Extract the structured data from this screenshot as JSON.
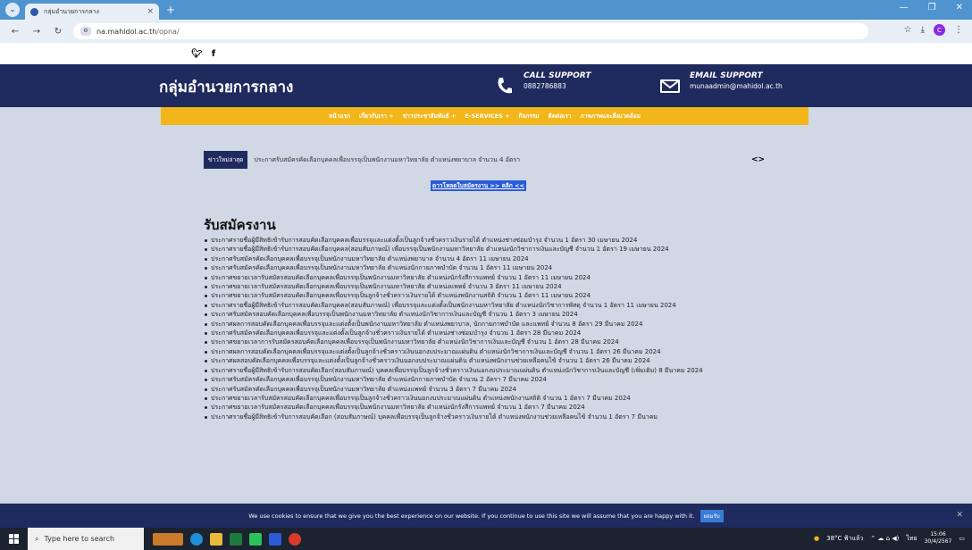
{
  "browser": {
    "tab_title": "กลุ่มอำนวยการกลาง",
    "tab_close": "×",
    "new_tab": "+",
    "url_host": "na.mahidol.ac.th",
    "url_path": "/opna/",
    "profile_initial": "C"
  },
  "site": {
    "brand": "กลุ่มอำนวยการกลาง",
    "call_support_label": "CALL SUPPORT",
    "call_support_value": "0882786883",
    "email_support_label": "EMAIL SUPPORT",
    "email_support_value": "munaadmin@mahidol.ac.th"
  },
  "menu": [
    "หน้าแรก",
    "เกี่ยวกับเรา +",
    "ข่าวประชาสัมพันธ์ +",
    "E-SERVICES +",
    "กิจกรรม",
    "ติดต่อเรา",
    "ภาพภาพและสิ่งแวดล้อม"
  ],
  "ticker": {
    "label": "ข่าวใหม่ล่าสุด",
    "text": "ประกาศรับสมัครคัดเลือกบุคคลเพื่อบรรจุเป็นพนักงานมหาวิทยาลัย ตำแหน่งพยาบาล จำนวน 4 อัตรา",
    "arrows": "<>"
  },
  "download_link": "ดาวโหลดใบสมัครงาน >> คลิก <<",
  "heading": "รับสมัครงาน",
  "jobs": [
    "ประกาศรายชื่อผู้มีสิทธิเข้ารับการสอบคัดเลือกบุคคลเพื่อบรรจุและแต่งตั้งเป็นลูกจ้างชั่วคราวเงินรายได้ ตำแหน่งช่างซ่อมบำรุง จำนวน 1 อัตรา 30 เมษายน 2024",
    "ประกาศรายชื่อผู้มีสิทธิเข้ารับการสอบคัดเลือกบุคคล(สอบสัมภาษณ์) เพื่อบรรจุเป็นพนักงานมหาวิทยาลัย ตำแหน่งนักวิชาการเงินและบัญชี จำนวน 1 อัตรา 19 เมษายน 2024",
    "ประกาศรับสมัครคัดเลือกบุคคลเพื่อบรรจุเป็นพนักงานมหาวิทยาลัย ตำแหน่งพยาบาล จำนวน 4 อัตรา 11 เมษายน 2024",
    "ประกาศรับสมัครคัดเลือกบุคคลเพื่อบรรจุเป็นพนักงานมหาวิทยาลัย ตำแหน่งนักกายภาพบำบัด จำนวน 1 อัตรา 11 เมษายน 2024",
    "ประกาศขยายเวลารับสมัครสอบคัดเลือกบุคคลเพื่อบรรจุเป็นพนักงานมหาวิทยาลัย ตำแหน่งนักรังสีการแพทย์ จำนวน 1 อัตรา 11 เมษายน 2024",
    "ประกาศขยายเวลารับสมัครสอบคัดเลือกบุคคลเพื่อบรรจุเป็นพนักงานมหาวิทยาลัย ตำแหน่งแพทย์ จำนวน 3 อัตรา 11 เมษายน 2024",
    "ประกาศขยายเวลารับสมัครสอบคัดเลือกบุคคลเพื่อบรรจุเป็นลูกจ้างชั่วคราวเงินรายได้ ตำแหน่งพนักงานสถิติ จำนวน 1 อัตรา 11 เมษายน 2024",
    "ประกาศรายชื่อผู้มีสิทธิเข้ารับการสอบคัดเลือกบุคคล(สอบสัมภาษณ์) เพื่อบรรจุและแต่งตั้งเป็นพนักงานมหาวิทยาลัย ตำแหน่งนักวิชาการพัสดุ จำนวน 1 อัตรา 11 เมษายน 2024",
    "ประกาศรับสมัครสอบคัดเลือกบุคคลเพื่อบรรจุเป็นพนักงานมหาวิทยาลัย ตำแหน่งนักวิชาการเงินและบัญชี จำนวน 1 อัตรา 3 เมษายน 2024",
    "ประกาศผลการสอบคัดเลือกบุคคลเพื่อบรรจุและแต่งตั้งเป็นพนักงานมหาวิทยาลัย ตำแหน่งพยาบาล, นักกายภาพบำบัด และแพทย์ จำนวน 8 อัตรา 29 มีนาคม 2024",
    "ประกาศรับสมัครคัดเลือกบุคคลเพื่อบรรจุและแต่งตั้งเป็นลูกจ้างชั่วคราวเงินรายได้ ตำแหน่งช่างซ่อมบำรุง จำนวน 1 อัตรา 28 มีนาคม 2024",
    "ประกาศขยายเวลาการรับสมัครสอบคัดเลือกบุคคลเพื่อบรรจุเป็นพนักงานมหาวิทยาลัย ตำแหน่งนักวิชาการเงินและบัญชี จำนวน 1 อัตรา 28 มีนาคม 2024",
    "ประกาศผลการสอบคัดเลือกบุคคลเพื่อบรรจุและแต่งตั้งเป็นลูกจ้างชั่วคราวเงินนอกงบประมาณแผ่นดิน ตำแหน่งนักวิชาการเงินและบัญชี จำนวน 1 อัตรา 26 มีนาคม 2024",
    "ประกาศผลสอบคัดเลือกบุคคลเพื่อบรรจุและแต่งตั้งเป็นลูกจ้างชั่วคราวเงินนอกงบประมาณแผ่นดิน ตำแหน่งพนักงานช่วยเหลือคนไข้ จำนวน 1 อัตรา 26 มีนาคม 2024",
    "ประกาศรายชื่อผู้มีสิทธิเข้ารับการสอบคัดเลือก(สอบสัมภาษณ์) บุคคลเพื่อบรรจุเป็นลูกจ้างชั่วคราวเงินนอกงบประมาณแผ่นดิน ตำแหน่งนักวิชาการเงินและบัญชี (เพิ่มเติม) 8 มีนาคม 2024",
    "ประกาศรับสมัครคัดเลือกบุคคลเพื่อบรรจุเป็นพนักงานมหาวิทยาลัย ตำแหน่งนักกายภาพบำบัด จำนวน 2 อัตรา 7 มีนาคม 2024",
    "ประกาศรับสมัครคัดเลือกบุคคลเพื่อบรรจุเป็นพนักงานมหาวิทยาลัย ตำแหน่งแพทย์ จำนวน 3 อัตรา 7 มีนาคม 2024",
    "ประกาศขยายเวลารับสมัครสอบคัดเลือกบุคคลเพื่อบรรจุเป็นลูกจ้างชั่วคราวเงินนอกงบประมาณแผ่นดิน ตำแหน่งพนักงานสถิติ จำนวน 1 อัตรา 7 มีนาคม 2024",
    "ประกาศขยายเวลารับสมัครสอบคัดเลือกบุคคลเพื่อบรรจุเป็นพนักงานมหาวิทยาลัย ตำแหน่งนักรังสีการแพทย์ จำนวน 1 อัตรา 7 มีนาคม 2024",
    "ประกาศรายชื่อผู้มีสิทธิเข้ารับการสอบคัดเลือก (สอบสัมภาษณ์) บุคคลเพื่อบรรจุเป็นลูกจ้างชั่วคราวเงินรายได้ ตำแหน่งพนักงานช่วยเหลือคนไข้ จำนวน 1 อัตรา 7 มีนาคม"
  ],
  "cookie": {
    "text": "We use cookies to ensure that we give you the best experience on our website. If you continue to use this site we will assume that you are happy with it.",
    "button": "ยอมรับ",
    "close": "✕"
  },
  "taskbar": {
    "search_placeholder": "Type here to search",
    "weather": "38°C ฟ้าแล้ว",
    "lang": "ไทย",
    "time": "15:06",
    "date": "30/4/2567"
  },
  "colors": {
    "header_navy": "#1f2a5e",
    "menu_yellow": "#f2b61a",
    "link_blue": "#2a5bd7"
  }
}
